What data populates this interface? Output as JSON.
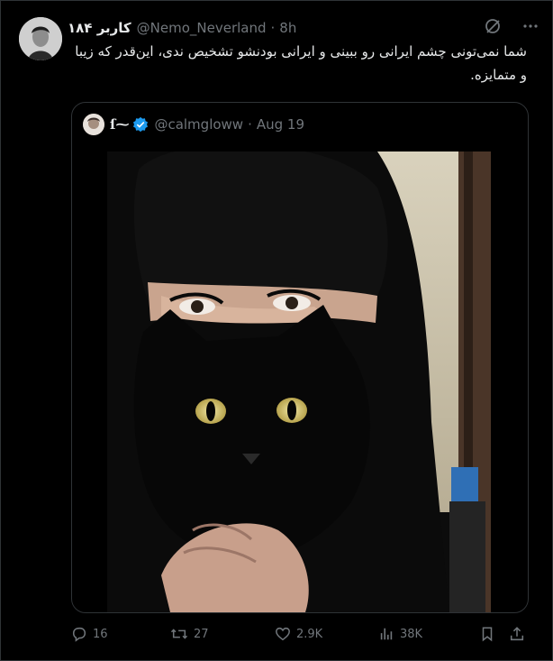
{
  "post": {
    "author_name": "کاربر ۱۸۴",
    "handle": "@Nemo_Neverland",
    "separator": "·",
    "time": "8h",
    "text": "شما نمی‌تونی چشم ایرانی رو ببینی و ایرانی بودنشو تشخیص ندی، این‌قدر که زیبا و متمایزه."
  },
  "quote": {
    "display_name": "ſ⁓",
    "handle": "@calmgloww",
    "separator": "·",
    "date": "Aug 19",
    "verified": true
  },
  "actions": {
    "replies": "16",
    "reposts": "27",
    "likes": "2.9K",
    "views": "38K"
  },
  "icons": [
    "grok-icon",
    "more-icon",
    "verified-icon",
    "reply-icon",
    "repost-icon",
    "like-icon",
    "views-icon",
    "bookmark-icon",
    "share-icon"
  ],
  "colors": {
    "background": "#000000",
    "text": "#e7e9ea",
    "muted": "#71767b",
    "border": "#2f3336",
    "verified": "#1d9bf0"
  }
}
